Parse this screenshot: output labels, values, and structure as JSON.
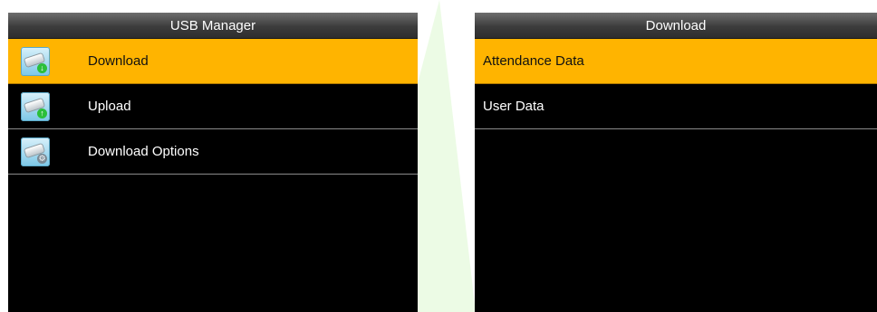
{
  "left_screen": {
    "title": "USB Manager",
    "items": [
      {
        "label": "Download",
        "icon": "usb-download-icon",
        "selected": true
      },
      {
        "label": "Upload",
        "icon": "usb-upload-icon",
        "selected": false
      },
      {
        "label": "Download Options",
        "icon": "usb-options-icon",
        "selected": false
      }
    ]
  },
  "right_screen": {
    "title": "Download",
    "items": [
      {
        "label": "Attendance Data",
        "selected": true
      },
      {
        "label": "User Data",
        "selected": false
      }
    ]
  },
  "colors": {
    "selected_bg": "#ffb400",
    "screen_bg": "#000000",
    "titlebar_bg": "#3c3c3c"
  }
}
